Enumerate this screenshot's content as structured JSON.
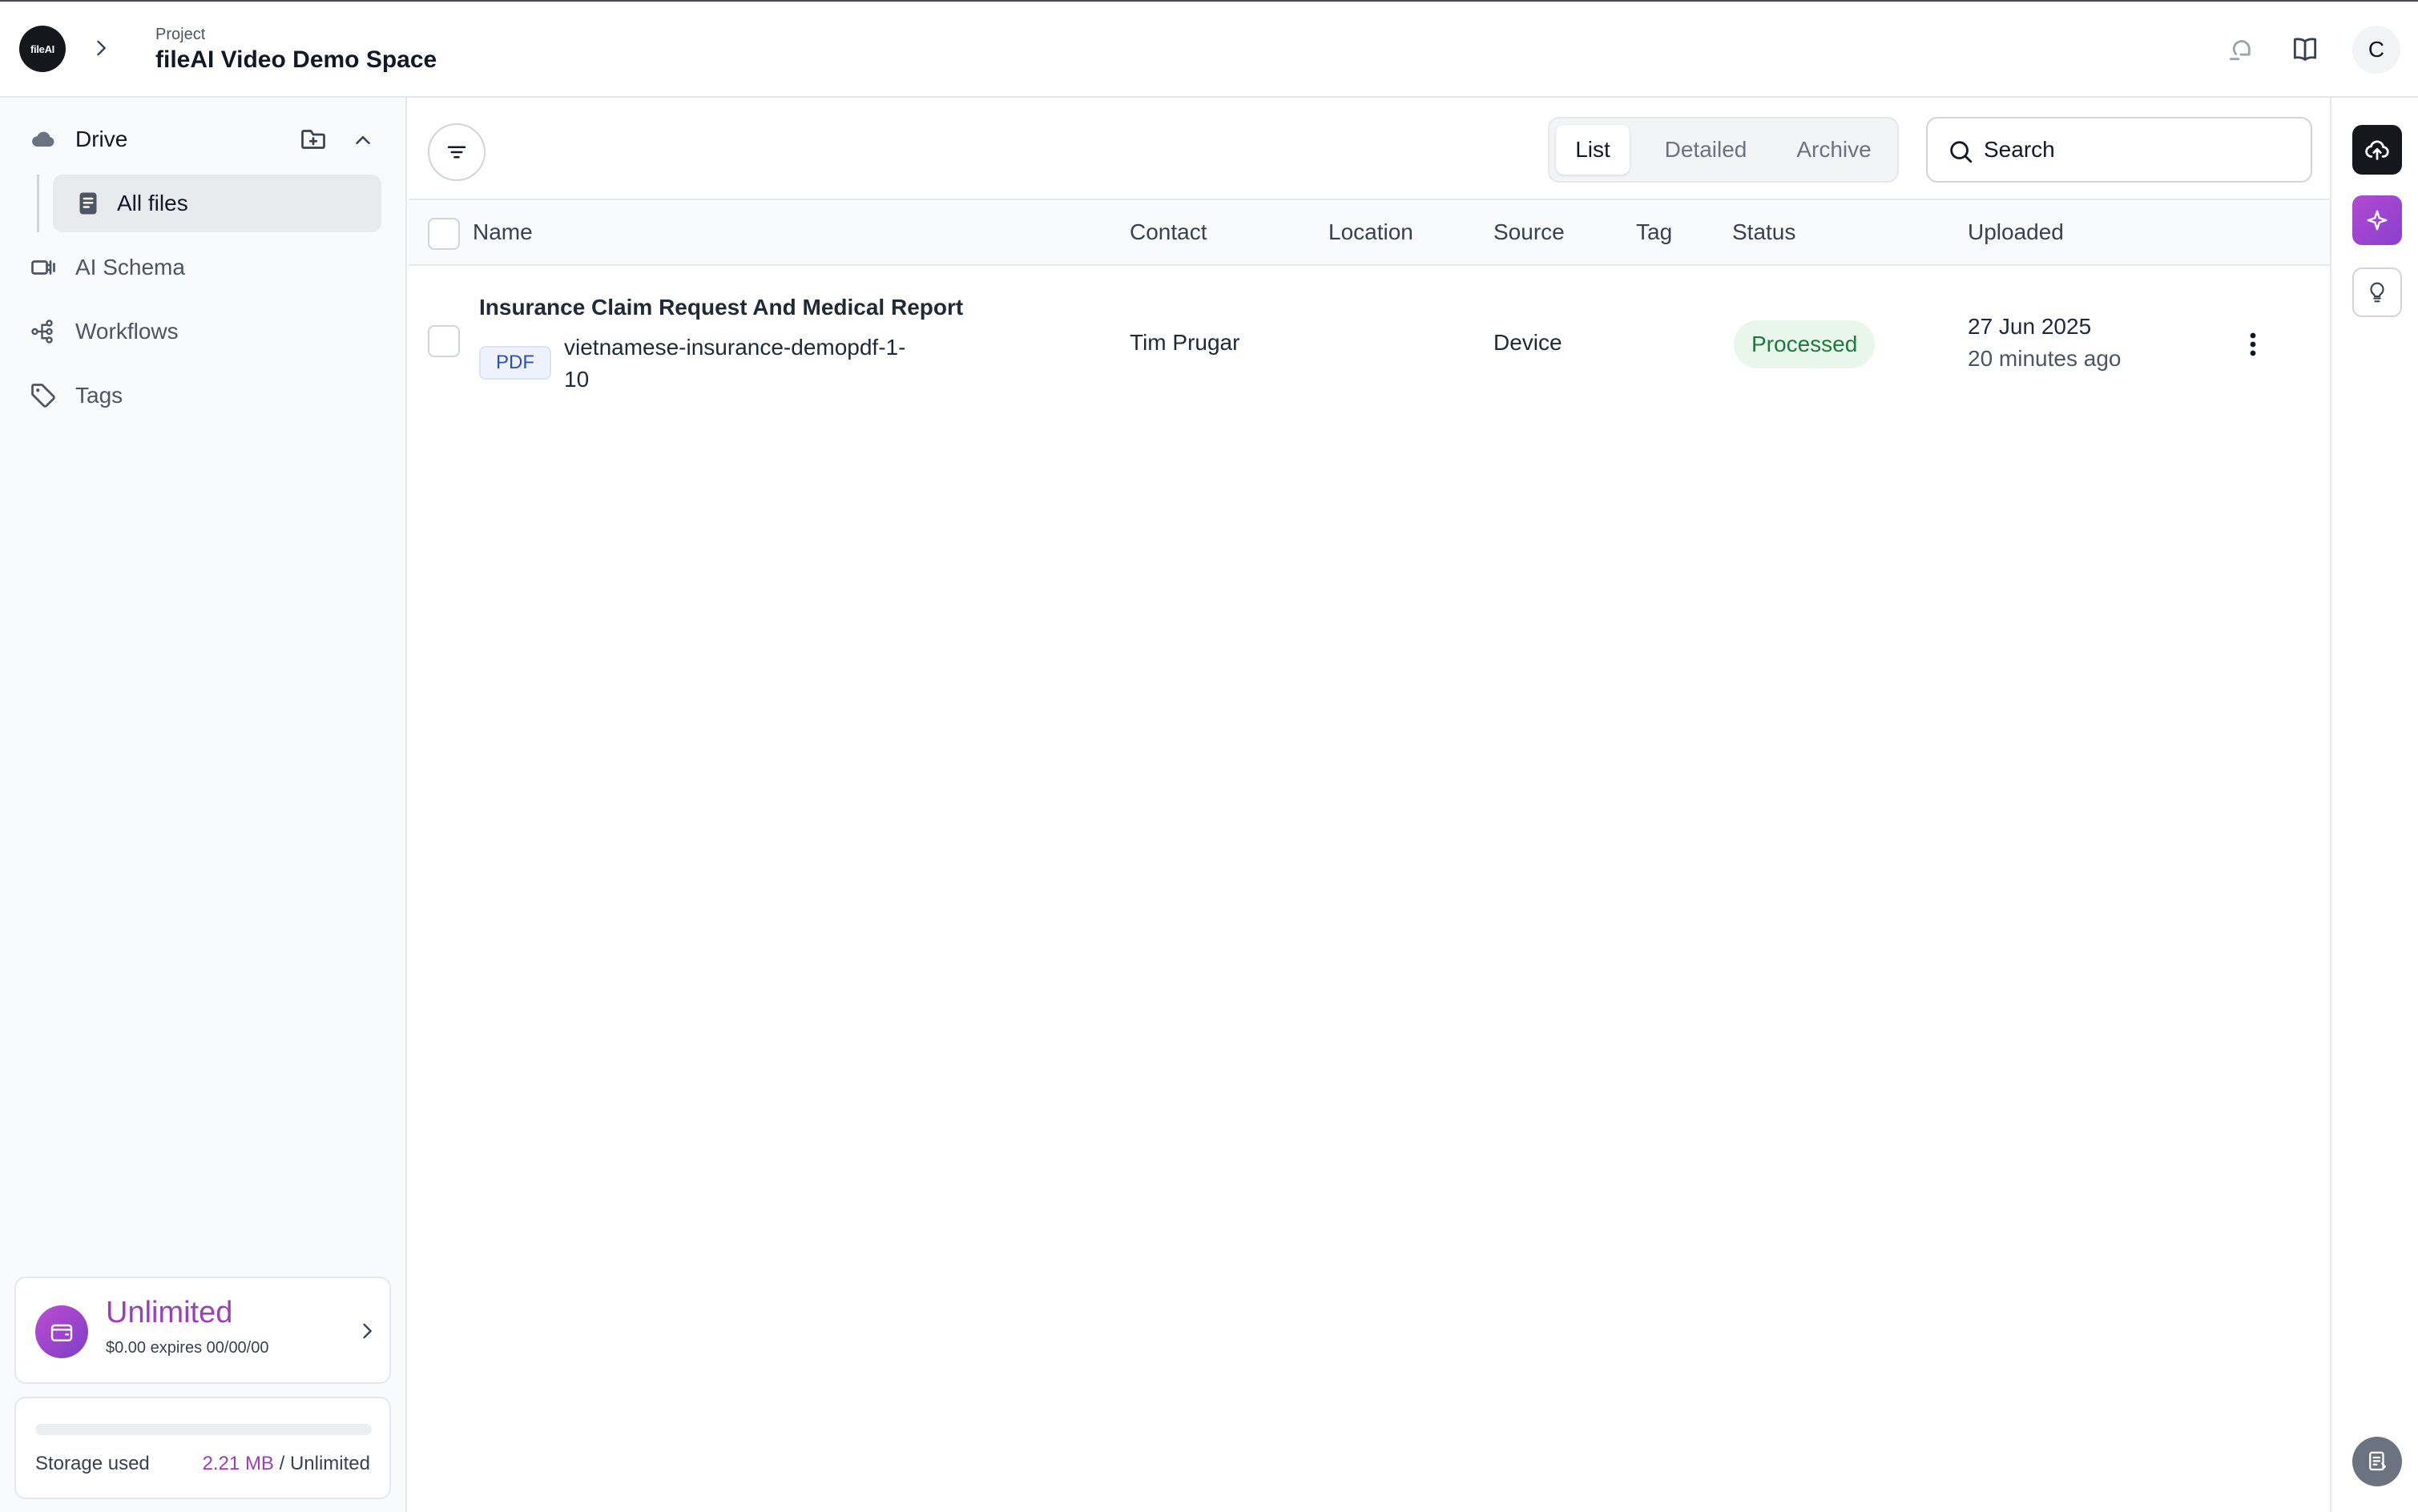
{
  "header": {
    "logo_text": "fileAI",
    "project_label": "Project",
    "project_name": "fileAI Video Demo Space",
    "avatar_initial": "C",
    "icons": [
      "chevron-right-icon",
      "notification-icon",
      "book-icon"
    ]
  },
  "sidebar": {
    "drive": {
      "label": "Drive",
      "icon": "cloud-icon"
    },
    "all_files": {
      "label": "All files",
      "icon": "document-icon"
    },
    "items": [
      {
        "label": "AI Schema",
        "icon": "schema-icon"
      },
      {
        "label": "Workflows",
        "icon": "workflow-icon"
      },
      {
        "label": "Tags",
        "icon": "tag-icon"
      }
    ],
    "plan": {
      "title": "Unlimited",
      "subtitle": "$0.00 expires 00/00/00"
    },
    "storage": {
      "label": "Storage used",
      "used": "2.21 MB",
      "total": "/ Unlimited",
      "fill_fraction": 0.0
    }
  },
  "toolbar": {
    "view_tabs": [
      {
        "label": "List",
        "active": true
      },
      {
        "label": "Detailed",
        "active": false
      },
      {
        "label": "Archive",
        "active": false
      }
    ],
    "search_placeholder": "Search"
  },
  "table": {
    "columns": [
      "Name",
      "Contact",
      "Location",
      "Source",
      "Tag",
      "Status",
      "Uploaded"
    ],
    "rows": [
      {
        "title": "Insurance Claim Request And Medical Report",
        "file_type": "PDF",
        "file_name": "vietnamese-insurance-demopdf-1-10",
        "contact": "Tim Prugar",
        "location": "",
        "source": "Device",
        "tag": "",
        "status": "Processed",
        "uploaded_date": "27 Jun 2025",
        "uploaded_relative": "20 minutes ago"
      }
    ]
  },
  "colors": {
    "accent_purple": "#9b3fb8",
    "status_green_bg": "#e8f6ec",
    "status_green_text": "#1e7a3c",
    "pdf_badge_text": "#2d4fb4",
    "dark": "#15171c"
  }
}
